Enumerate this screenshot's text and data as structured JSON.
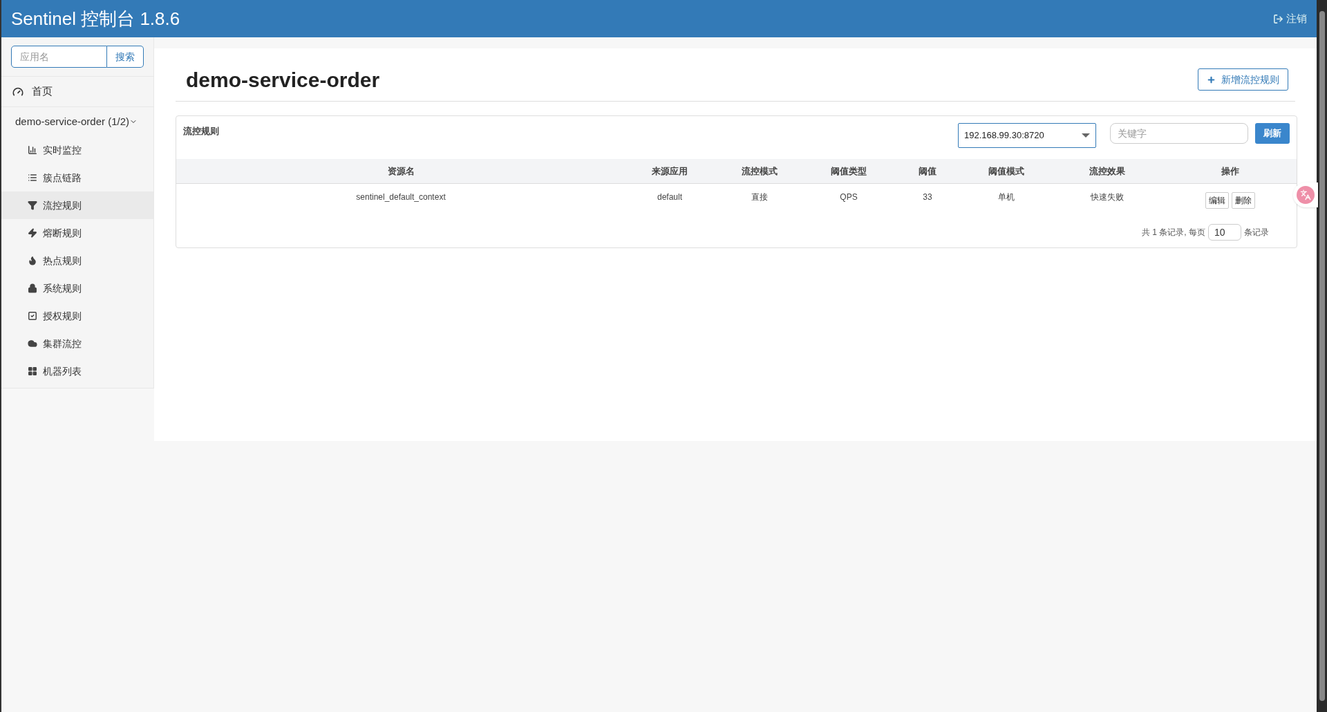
{
  "header": {
    "title": "Sentinel 控制台 1.8.6",
    "logout": "注销"
  },
  "sidebar": {
    "search": {
      "placeholder": "应用名",
      "button": "搜索"
    },
    "home": "首页",
    "app": {
      "label": "demo-service-order (1/2)",
      "expanded": true,
      "items": [
        {
          "label": "实时监控",
          "selected": false
        },
        {
          "label": "簇点链路",
          "selected": false
        },
        {
          "label": "流控规则",
          "selected": true
        },
        {
          "label": "熔断规则",
          "selected": false
        },
        {
          "label": "热点规则",
          "selected": false
        },
        {
          "label": "系统规则",
          "selected": false
        },
        {
          "label": "授权规则",
          "selected": false
        },
        {
          "label": "集群流控",
          "selected": false
        },
        {
          "label": "机器列表",
          "selected": false
        }
      ]
    }
  },
  "page": {
    "title": "demo-service-order",
    "add_button": "新增流控规则"
  },
  "panel": {
    "title": "流控规则",
    "machine": "192.168.99.30:8720",
    "keyword": {
      "placeholder": "关键字"
    },
    "refresh": "刷新",
    "table": {
      "columns": [
        "资源名",
        "来源应用",
        "流控模式",
        "阈值类型",
        "阈值",
        "阈值模式",
        "流控效果",
        "操作"
      ],
      "rows": [
        {
          "cells": [
            "sentinel_default_context",
            "default",
            "直接",
            "QPS",
            "33",
            "单机",
            "快速失败"
          ],
          "actions": [
            "编辑",
            "删除"
          ]
        }
      ]
    },
    "pagination": {
      "prefix": "共 1 条记录, 每页",
      "page_size": "10",
      "suffix": "条记录"
    }
  }
}
